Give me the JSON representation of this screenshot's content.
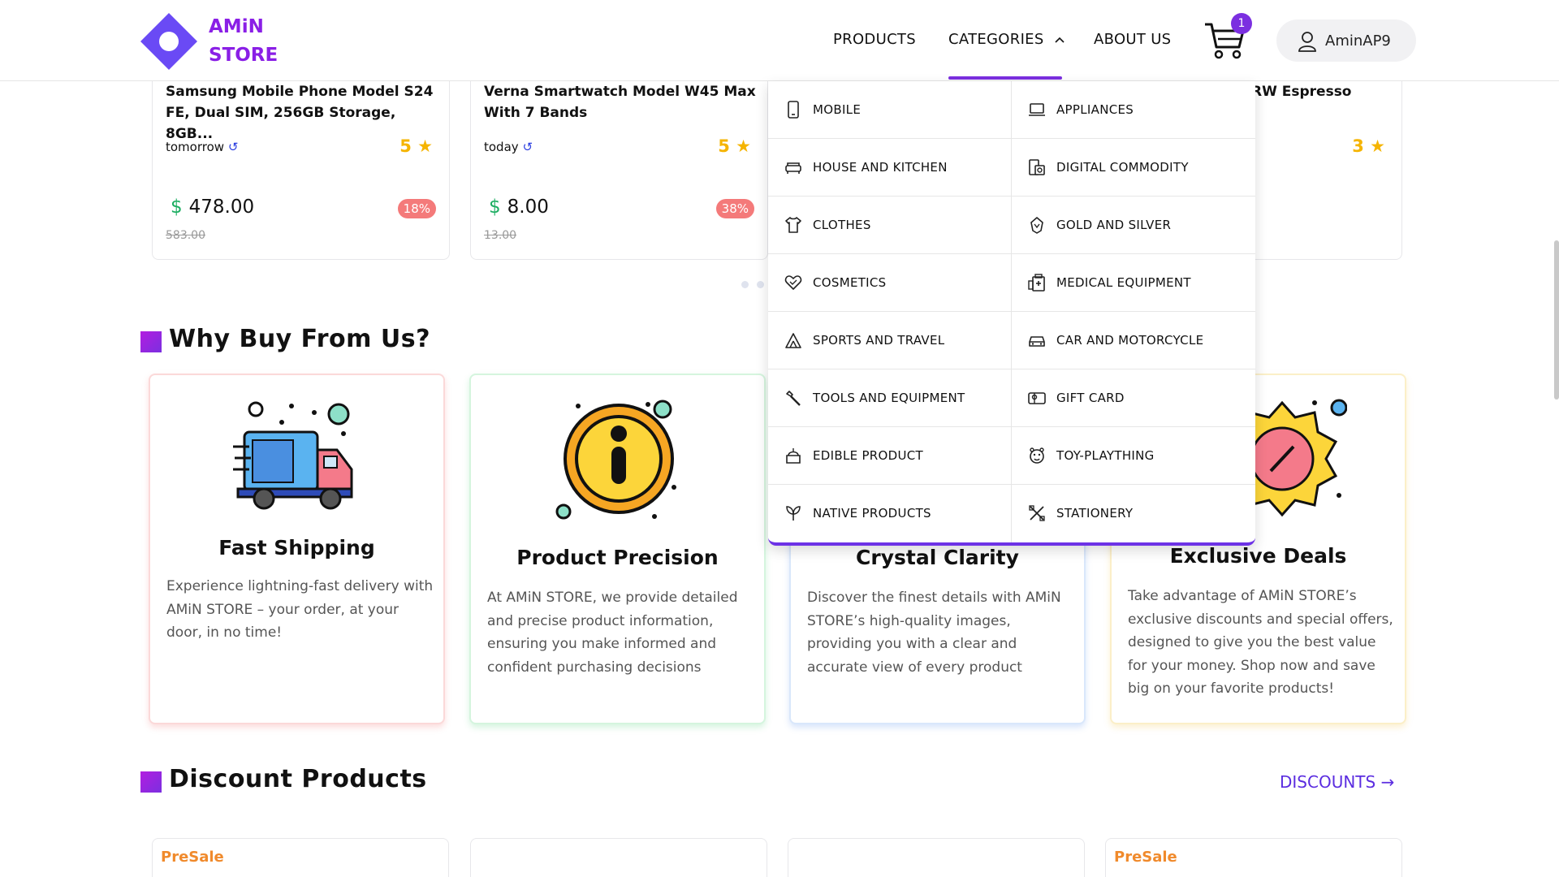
{
  "header": {
    "logo_line1": "AMiN",
    "logo_line2": "STORE",
    "nav": {
      "products": "PRODUCTS",
      "categories": "CATEGORIES",
      "about": "ABOUT US"
    },
    "cart_count": "1",
    "username": "AminAP9"
  },
  "product_strip": [
    {
      "title": "Samsung Mobile Phone Model S24 FE, Dual SIM, 256GB Storage, 8GB...",
      "when": "tomorrow",
      "rating": "5",
      "price": "478.00",
      "old_price": "583.00",
      "discount": "18%"
    },
    {
      "title": "Verna Smartwatch Model W45 Max With 7 Bands",
      "when": "today",
      "rating": "5",
      "price": "8.00",
      "old_price": "13.00",
      "discount": "38%"
    },
    {
      "title": "RW Espresso",
      "rating": "3"
    }
  ],
  "currency_symbol": "$",
  "why_section": {
    "title": "Why Buy From Us?",
    "cards": [
      {
        "title": "Fast Shipping",
        "desc": "Experience lightning-fast delivery with AMiN STORE – your order, at your door, in no time!"
      },
      {
        "title": "Product Precision",
        "desc": "At AMiN STORE, we provide detailed and precise product information, ensuring you make informed and confident purchasing decisions"
      },
      {
        "title": "Crystal Clarity",
        "desc": "Discover the finest details with AMiN STORE’s high-quality images, providing you with a clear and accurate view of every product"
      },
      {
        "title": "Exclusive Deals",
        "desc": "Take advantage of AMiN STORE’s exclusive discounts and special offers, designed to give you the best value for your money. Shop now and save big on your favorite products!"
      }
    ]
  },
  "discount_section": {
    "title": "Discount Products",
    "link": "DISCOUNTS →",
    "presale_label": "PreSale"
  },
  "categories_menu": [
    {
      "label": "MOBILE",
      "icon": "mobile-icon"
    },
    {
      "label": "APPLIANCES",
      "icon": "laptop-icon"
    },
    {
      "label": "HOUSE AND KITCHEN",
      "icon": "sofa-icon"
    },
    {
      "label": "DIGITAL COMMODITY",
      "icon": "devices-icon"
    },
    {
      "label": "CLOTHES",
      "icon": "shirt-icon"
    },
    {
      "label": "GOLD AND SILVER",
      "icon": "diamond-icon"
    },
    {
      "label": "COSMETICS",
      "icon": "heart-icon"
    },
    {
      "label": "MEDICAL EQUIPMENT",
      "icon": "medical-icon"
    },
    {
      "label": "SPORTS AND TRAVEL",
      "icon": "tent-icon"
    },
    {
      "label": "CAR AND MOTORCYCLE",
      "icon": "car-icon"
    },
    {
      "label": "TOOLS AND EQUIPMENT",
      "icon": "wrench-icon"
    },
    {
      "label": "GIFT CARD",
      "icon": "gift-card-icon"
    },
    {
      "label": "EDIBLE PRODUCT",
      "icon": "food-icon"
    },
    {
      "label": "TOY-PLAYTHING",
      "icon": "toy-icon"
    },
    {
      "label": "NATIVE PRODUCTS",
      "icon": "plant-icon"
    },
    {
      "label": "STATIONERY",
      "icon": "stationery-icon"
    }
  ],
  "colors": {
    "brand": "#7b2fe0",
    "logo": "#8a1fe6",
    "price_dollar": "#1dae62",
    "rating": "#f5b400",
    "discount_badge": "#f47a7a",
    "presale": "#f08a2c"
  }
}
